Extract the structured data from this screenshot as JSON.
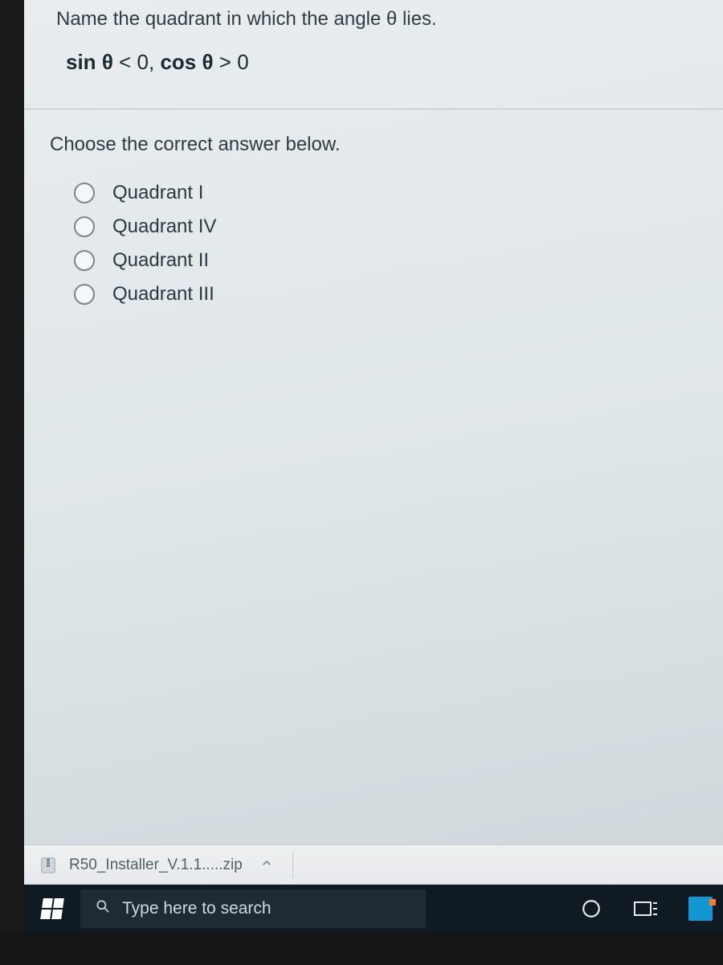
{
  "question": {
    "prompt": "Name the quadrant in which the angle θ lies.",
    "condition_html": "sin θ < 0,  cos θ > 0",
    "sin_label": "sin",
    "cos_label": "cos",
    "theta": "θ",
    "lt0": "< 0",
    "gt0": "> 0",
    "comma": ", "
  },
  "choose_text": "Choose the correct answer below.",
  "options": [
    {
      "label": "Quadrant I"
    },
    {
      "label": "Quadrant IV"
    },
    {
      "label": "Quadrant II"
    },
    {
      "label": "Quadrant III"
    }
  ],
  "downloads": {
    "filename": "R50_Installer_V.1.1.....zip"
  },
  "taskbar": {
    "search_placeholder": "Type here to search"
  }
}
